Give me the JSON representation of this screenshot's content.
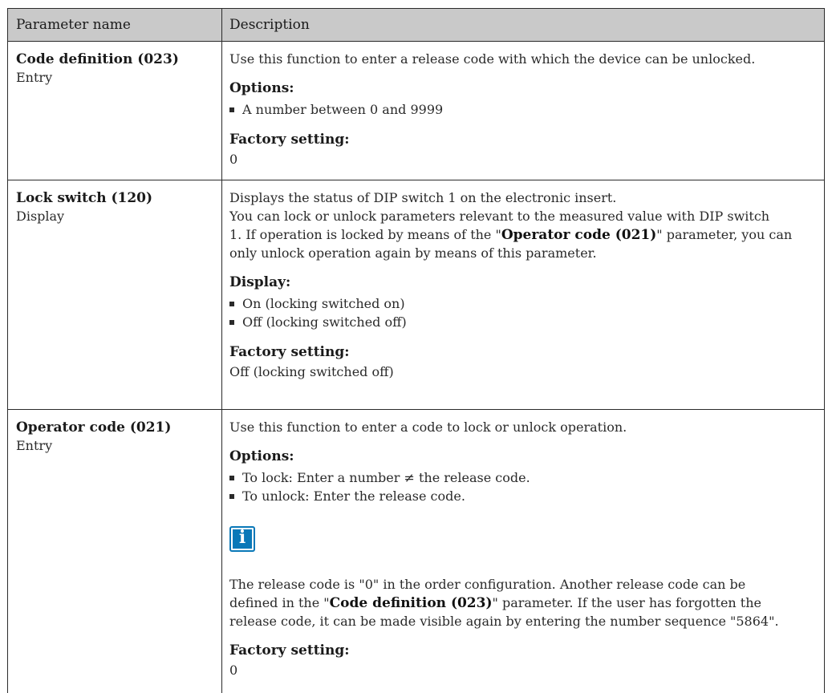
{
  "header": {
    "col1": "Parameter name",
    "col2": "Description"
  },
  "rows": [
    {
      "name": "Code definition (023)",
      "type": "Entry",
      "text": "Use this function to enter a release code with which the device can be unlocked.",
      "options_label": "Options:",
      "options": [
        "A number between 0 and 9999"
      ],
      "factory_label": "Factory setting:",
      "factory": "0"
    },
    {
      "name": "Lock switch (120)",
      "type": "Display",
      "text1": "Displays the status of DIP switch 1 on the electronic insert.",
      "text2a": "You can lock or unlock parameters relevant to the measured value with DIP switch",
      "text2b_pre": "1. If operation is locked by means of the \"",
      "text2b_bold": "Operator code (021)",
      "text2b_post": "\" parameter, you can",
      "text2c": "only unlock operation again by means of this parameter.",
      "display_label": "Display:",
      "display": [
        "On (locking switched on)",
        "Off (locking switched off)"
      ],
      "factory_label": "Factory setting:",
      "factory": "Off (locking switched off)"
    },
    {
      "name": "Operator code (021)",
      "type": "Entry",
      "text": "Use this function to enter a code to lock or unlock operation.",
      "options_label": "Options:",
      "options": [
        "To lock: Enter a number ≠ the release code.",
        "To unlock: Enter the release code."
      ],
      "note_icon": "info-icon",
      "note_icon_glyph": "i",
      "note1": "The release code is \"0\" in the order configuration. Another release code can be",
      "note2_pre": "defined in the \"",
      "note2_bold": "Code definition (023)",
      "note2_post": "\" parameter. If the user has forgotten the",
      "note3": "release code, it can be made visible again by entering the number sequence \"5864\".",
      "factory_label": "Factory setting:",
      "factory": "0"
    }
  ]
}
